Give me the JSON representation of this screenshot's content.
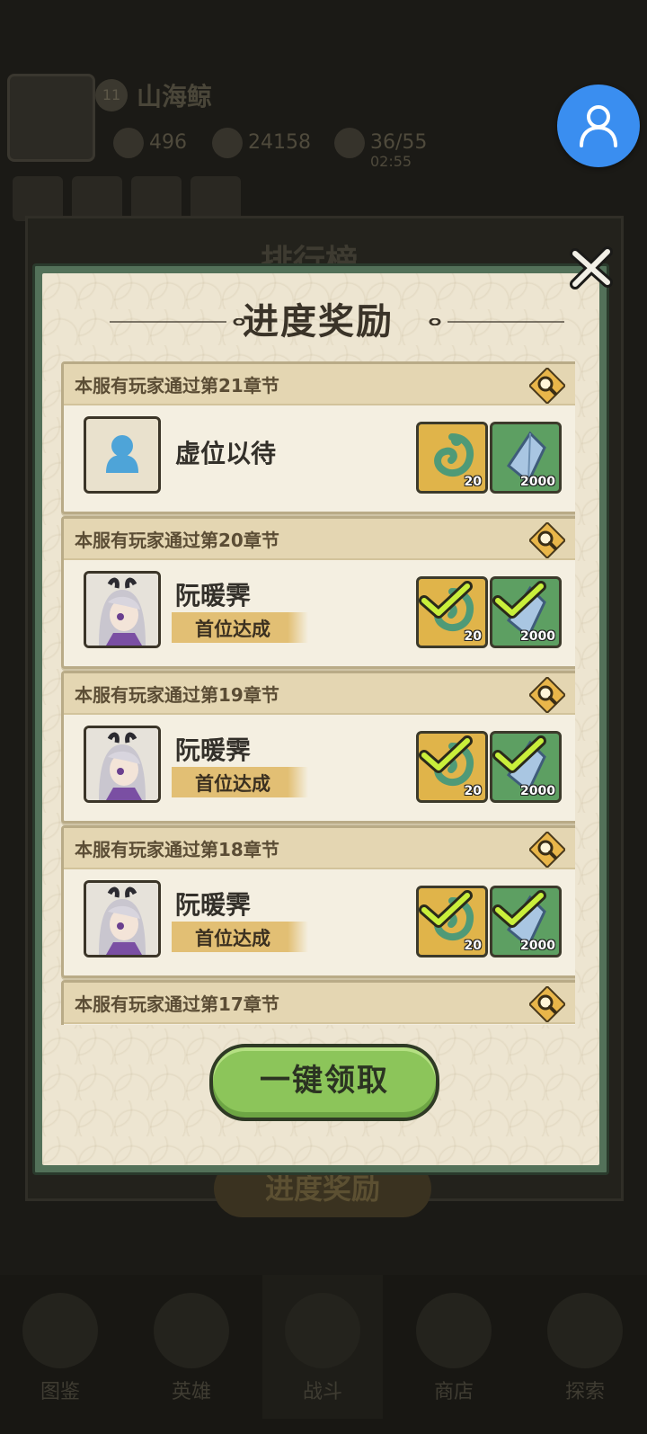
{
  "background": {
    "player_level": "11",
    "player_name": "山海鲸",
    "stats": [
      "496",
      "24158",
      "36/55"
    ],
    "stamina_timer": "02:55",
    "panel_title": "排行榜",
    "bottom_button": "进度奖励",
    "nav": [
      "图鉴",
      "英雄",
      "战斗",
      "商店",
      "探索"
    ]
  },
  "modal": {
    "title": "进度奖励",
    "claim_all_label": "一键领取",
    "entries": [
      {
        "header": "本服有玩家通过第21章节",
        "player": "虚位以待",
        "achievement": "",
        "rewards": [
          {
            "qty": "20",
            "kind": "jade-dragon",
            "claimed": false
          },
          {
            "qty": "2000",
            "kind": "crystal",
            "claimed": false
          }
        ]
      },
      {
        "header": "本服有玩家通过第20章节",
        "player": "阮暖霁",
        "achievement": "首位达成",
        "rewards": [
          {
            "qty": "20",
            "kind": "jade-dragon",
            "claimed": true
          },
          {
            "qty": "2000",
            "kind": "crystal",
            "claimed": true
          }
        ]
      },
      {
        "header": "本服有玩家通过第19章节",
        "player": "阮暖霁",
        "achievement": "首位达成",
        "rewards": [
          {
            "qty": "20",
            "kind": "jade-dragon",
            "claimed": true
          },
          {
            "qty": "2000",
            "kind": "crystal",
            "claimed": true
          }
        ]
      },
      {
        "header": "本服有玩家通过第18章节",
        "player": "阮暖霁",
        "achievement": "首位达成",
        "rewards": [
          {
            "qty": "20",
            "kind": "jade-dragon",
            "claimed": true
          },
          {
            "qty": "2000",
            "kind": "crystal",
            "claimed": true
          }
        ]
      },
      {
        "header": "本服有玩家通过第17章节",
        "player": "",
        "achievement": "",
        "rewards": []
      }
    ]
  },
  "colors": {
    "accent_gold": "#e0b44a",
    "accent_green": "#5d9f62",
    "button_green": "#8cc55a",
    "check_green": "#c9ef3b"
  }
}
